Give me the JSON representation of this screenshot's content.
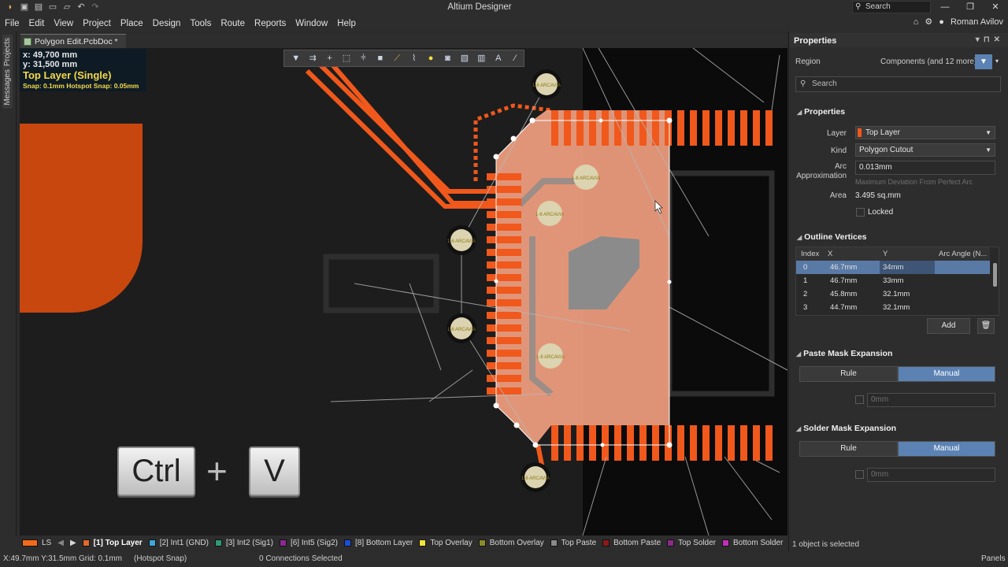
{
  "window": {
    "title": "Altium Designer",
    "search_placeholder": "Search",
    "user": "Roman Avilov"
  },
  "menu": [
    "File",
    "Edit",
    "View",
    "Project",
    "Place",
    "Design",
    "Tools",
    "Route",
    "Reports",
    "Window",
    "Help"
  ],
  "left_tabs": [
    "Projects",
    "Messages"
  ],
  "document": {
    "tab_label": "Polygon Edit.PcbDoc *"
  },
  "hud": {
    "x": "x: 49,700 mm",
    "y": "y: 31,500 mm",
    "layer": "Top Layer (Single)",
    "snap": "Snap: 0.1mm Hotspot Snap: 0.05mm"
  },
  "canvas_toolbar": [
    "filter-icon",
    "route-icon",
    "cross-icon",
    "select-rect-icon",
    "align-icon",
    "fill-icon",
    "polygon-icon",
    "dimension-icon",
    "pad-icon",
    "via-icon",
    "rect-icon",
    "chart-icon",
    "text-icon",
    "line-icon"
  ],
  "overlay_keys": {
    "ctrl": "Ctrl",
    "plus": "+",
    "key": "V"
  },
  "pad_label": "1-6 ARCAVIA",
  "layers": [
    {
      "label": "LS",
      "color": "#f26a1b"
    },
    {
      "label": "[1] Top Layer",
      "color": "#e06a30",
      "active": true
    },
    {
      "label": "[2] Int1 (GND)",
      "color": "#3fa7d6"
    },
    {
      "label": "[3] Int2 (Sig1)",
      "color": "#2f9a72"
    },
    {
      "label": "[6] Int5 (Sig2)",
      "color": "#8b2a92"
    },
    {
      "label": "[8] Bottom Layer",
      "color": "#1a4fd6"
    },
    {
      "label": "Top Overlay",
      "color": "#f2e23a"
    },
    {
      "label": "Bottom Overlay",
      "color": "#8b8b2a"
    },
    {
      "label": "Top Paste",
      "color": "#8a8a8a"
    },
    {
      "label": "Bottom Paste",
      "color": "#8a1a1a"
    },
    {
      "label": "Top Solder",
      "color": "#8b2a8b"
    },
    {
      "label": "Bottom Solder",
      "color": "#c22fb8"
    }
  ],
  "status": {
    "coords": "X:49.7mm Y:31.5mm",
    "grid": "Grid: 0.1mm",
    "snap": "(Hotspot Snap)",
    "connections": "0 Connections Selected",
    "panels": "Panels"
  },
  "panel": {
    "title": "Properties",
    "region_label": "Region",
    "filter_label": "Components (and 12 more)",
    "search_placeholder": "Search",
    "properties_section": "Properties",
    "layer_label": "Layer",
    "layer_value": "Top Layer",
    "kind_label": "Kind",
    "kind_value": "Polygon Cutout",
    "arc_label": "Arc Approximation",
    "arc_value": "0.013mm",
    "arc_hint": "Maximum Deviation From Perfect Arc",
    "area_label": "Area",
    "area_value": "3.495 sq.mm",
    "locked_label": "Locked",
    "vertices_section": "Outline Vertices",
    "vertex_headers": [
      "Index",
      "X",
      "Y",
      "Arc Angle (N..."
    ],
    "vertices": [
      {
        "index": "0",
        "x": "46.7mm",
        "y": "34mm"
      },
      {
        "index": "1",
        "x": "46.7mm",
        "y": "33mm"
      },
      {
        "index": "2",
        "x": "45.8mm",
        "y": "32.1mm"
      },
      {
        "index": "3",
        "x": "44.7mm",
        "y": "32.1mm"
      }
    ],
    "add_label": "Add",
    "paste_section": "Paste Mask Expansion",
    "solder_section": "Solder Mask Expansion",
    "rule_label": "Rule",
    "manual_label": "Manual",
    "paste_value": "0mm",
    "solder_value": "0mm",
    "footer": "1 object is selected"
  },
  "colors": {
    "copper": "#f0581c",
    "selection": "#f2a080",
    "accent": "#5b82b3"
  }
}
